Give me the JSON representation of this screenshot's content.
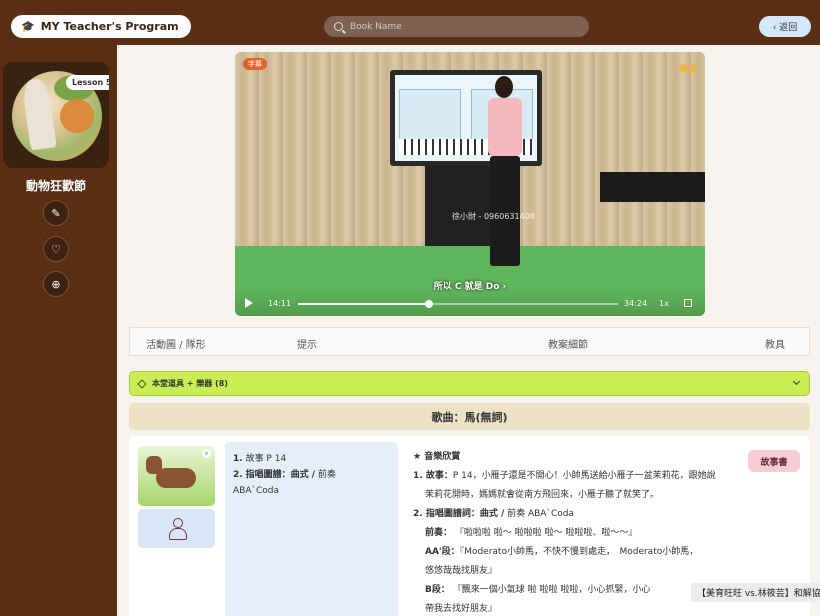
{
  "header": {
    "brand_icon": "graduation-cap-icon",
    "brand_label": "MY Teacher's Program",
    "search_placeholder": "Book Name",
    "back_label": "‹ 返回"
  },
  "sidebar": {
    "lesson_badge": "Lesson 5",
    "book_title": "動物狂歡節",
    "buttons": [
      {
        "name": "pencil-icon",
        "glyph": "✎"
      },
      {
        "name": "heart-icon",
        "glyph": "♡"
      },
      {
        "name": "zoom-in-icon",
        "glyph": "⊕"
      }
    ]
  },
  "video": {
    "caption_badge": "字幕",
    "brand_logo": "美育",
    "watermark": "徐小財 - 0960631408",
    "subtitle": "所以 C 就是 Do ›",
    "time_elapsed": "14:11",
    "time_total": "34:24",
    "speed": "1x",
    "progress": 0.41
  },
  "tabs": [
    "活動圖 / 隊形",
    "提示",
    "教案細節",
    "教具"
  ],
  "tools_bar": {
    "label": "本堂道具 + 樂器 (8)"
  },
  "song_title": "歌曲：馬(無詞)",
  "card": {
    "notes": {
      "line1_num": "1.",
      "line1": "故事 P 14",
      "line2_num": "2.",
      "line2_bold": "指唱圖譜：曲式 /",
      "line2_rest": " 前奏",
      "line3": "ABA`Coda"
    },
    "detail": {
      "heading": "★ 音樂欣賞",
      "p1_num": "1. 故事：",
      "p1": "P 14，小雁子還是不開心！小帥馬送給小雁子一盆茉莉花，跟她說",
      "p1b": "茉莉花開時，媽媽就會從南方飛回來，小雁子聽了就笑了。",
      "p2_num": "2. 指唱圖譜詞：曲式 /",
      "p2": " 前奏 ABA`Coda",
      "p3_label": "前奏：",
      "p3": "『啦啦啦 啦～ 啦啦啦 啦～ 啦啦啦、啦～～』",
      "p4_label": "AA'段：",
      "p4": "『Moderato小帥馬，不快不慢到處走，　Moderato小帥馬，",
      "p4b": "悠悠哉哉找朋友』",
      "p5_label": "B段：",
      "p5": "『飄來一個小氣球 啦 啦啦 啦啦，小心抓緊，小心",
      "p5b": "帶我去找好朋友』"
    },
    "story_button": "故事書"
  },
  "ticker": "【美育旺旺 vs.林筱芸】和解協議"
}
